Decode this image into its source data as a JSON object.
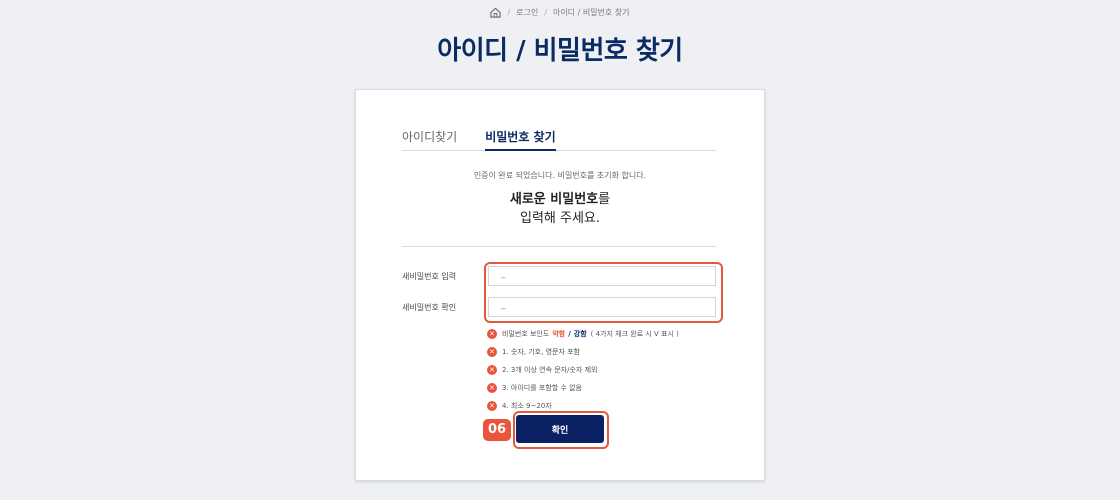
{
  "breadcrumb": {
    "items": [
      "로그인",
      "아이디 / 비밀번호 찾기"
    ],
    "separator": "/"
  },
  "page_title": "아이디 / 비밀번호 찾기",
  "tabs": [
    {
      "label": "아이디찾기",
      "active": false
    },
    {
      "label": "비밀번호 찾기",
      "active": true
    }
  ],
  "notice": "인증이 완료 되었습니다. 비밀번호를 초기화 합니다.",
  "headline": {
    "bold": "새로운 비밀번호",
    "rest1": "를",
    "line2": "입력해 주세요."
  },
  "form": {
    "new_password_label": "새비밀번호 입력",
    "new_password_value": "_",
    "confirm_password_label": "새비밀번호 확인",
    "confirm_password_value": "_"
  },
  "rules": {
    "strength_prefix": "비밀번호 보안도",
    "strength_weak": "약함",
    "strength_slash": "/",
    "strength_strong": "강함",
    "strength_note": "( 4가지 체크 완료 시 V 표시 )",
    "items": [
      "1. 숫자, 기호, 영문자 포함",
      "2. 3개 이상 연속 문자/숫자 제외",
      "3. 아이디를 포함할 수 없음",
      "4. 최소 9~20자"
    ]
  },
  "step_badge": "06",
  "confirm_label": "확인",
  "colors": {
    "navy": "#0b2b63",
    "accent": "#e8553a"
  }
}
